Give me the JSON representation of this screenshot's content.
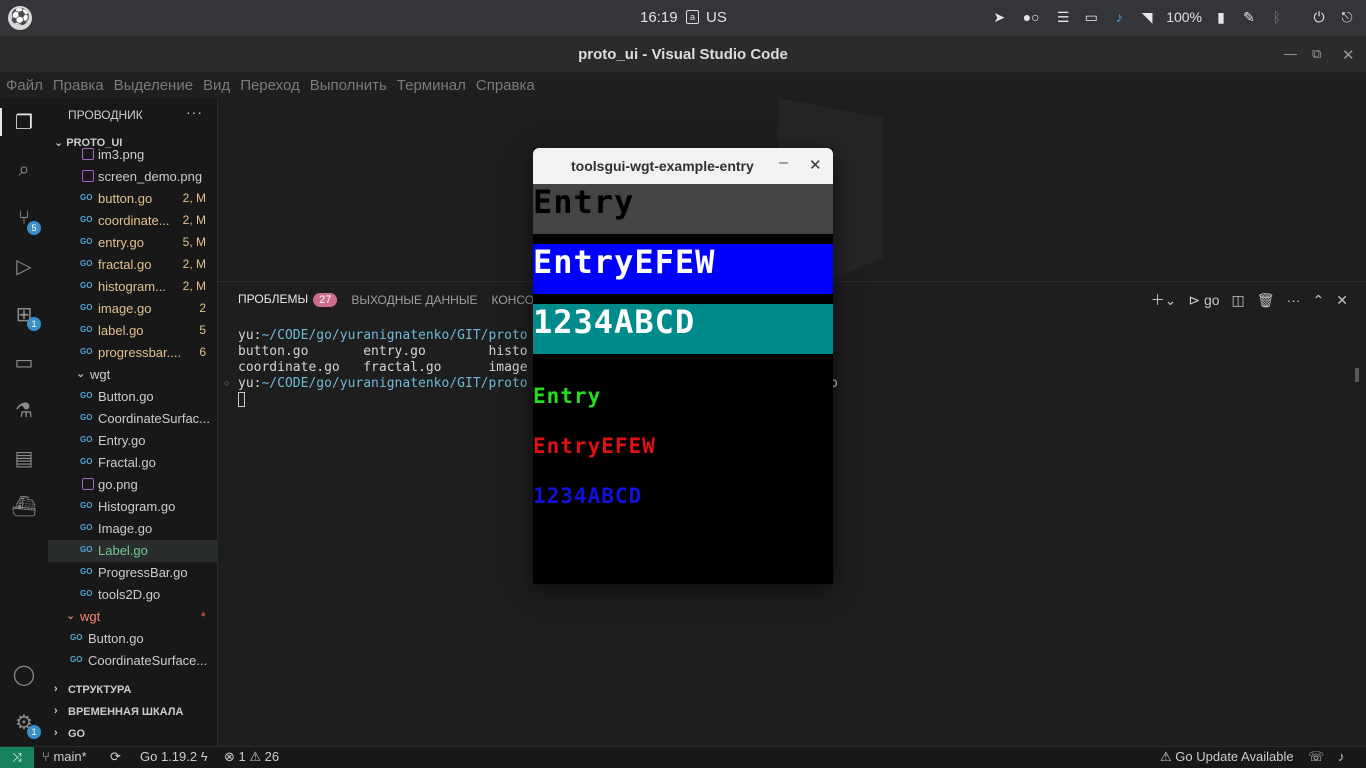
{
  "system_bar": {
    "clock": "16:19",
    "keyboard_layout": "US",
    "battery": "100%"
  },
  "window": {
    "title": "proto_ui - Visual Studio Code"
  },
  "menu": [
    "Файл",
    "Правка",
    "Выделение",
    "Вид",
    "Переход",
    "Выполнить",
    "Терминал",
    "Справка"
  ],
  "activity": {
    "scm_badge": "5",
    "extensions_badge": "1",
    "settings_badge": "1"
  },
  "sidebar": {
    "header": "ПРОВОДНИК",
    "more": "···",
    "project": "PROTO_UI",
    "files": [
      {
        "name": "im3.png",
        "status": "",
        "kind": "png",
        "level": 1,
        "color": "normal"
      },
      {
        "name": "screen_demo.png",
        "status": "",
        "kind": "png",
        "level": 1,
        "color": "normal"
      },
      {
        "name": "button.go",
        "status": "2, M",
        "kind": "go",
        "level": 1,
        "color": "mod"
      },
      {
        "name": "coordinate...",
        "status": "2, M",
        "kind": "go",
        "level": 1,
        "color": "mod"
      },
      {
        "name": "entry.go",
        "status": "5, M",
        "kind": "go",
        "level": 1,
        "color": "mod"
      },
      {
        "name": "fractal.go",
        "status": "2, M",
        "kind": "go",
        "level": 1,
        "color": "mod"
      },
      {
        "name": "histogram...",
        "status": "2, M",
        "kind": "go",
        "level": 1,
        "color": "mod"
      },
      {
        "name": "image.go",
        "status": "2",
        "kind": "go",
        "level": 1,
        "color": "mod"
      },
      {
        "name": "label.go",
        "status": "5",
        "kind": "go",
        "level": 1,
        "color": "mod"
      },
      {
        "name": "progressbar....",
        "status": "6",
        "kind": "go",
        "level": 1,
        "color": "mod"
      },
      {
        "name": "wgt",
        "status": "",
        "kind": "folder",
        "level": 1,
        "color": "normal"
      },
      {
        "name": "Button.go",
        "status": "",
        "kind": "go",
        "level": 1,
        "color": "normal"
      },
      {
        "name": "CoordinateSurfac...",
        "status": "",
        "kind": "go",
        "level": 1,
        "color": "normal"
      },
      {
        "name": "Entry.go",
        "status": "",
        "kind": "go",
        "level": 1,
        "color": "normal"
      },
      {
        "name": "Fractal.go",
        "status": "",
        "kind": "go",
        "level": 1,
        "color": "normal"
      },
      {
        "name": "go.png",
        "status": "",
        "kind": "png",
        "level": 1,
        "color": "normal"
      },
      {
        "name": "Histogram.go",
        "status": "",
        "kind": "go",
        "level": 1,
        "color": "normal"
      },
      {
        "name": "Image.go",
        "status": "",
        "kind": "go",
        "level": 1,
        "color": "normal"
      },
      {
        "name": "Label.go",
        "status": "",
        "kind": "go",
        "level": 1,
        "color": "green"
      },
      {
        "name": "ProgressBar.go",
        "status": "",
        "kind": "go",
        "level": 1,
        "color": "normal"
      },
      {
        "name": "tools2D.go",
        "status": "",
        "kind": "go",
        "level": 1,
        "color": "normal"
      },
      {
        "name": "wgt",
        "status": "●",
        "kind": "folder",
        "level": 0,
        "color": "err"
      },
      {
        "name": "Button.go",
        "status": "",
        "kind": "go",
        "level": 0,
        "color": "normal"
      },
      {
        "name": "CoordinateSurface...",
        "status": "",
        "kind": "go",
        "level": 0,
        "color": "normal"
      }
    ],
    "sections": [
      "СТРУКТУРА",
      "ВРЕМЕННАЯ ШКАЛА",
      "GO"
    ]
  },
  "panel": {
    "tabs": [
      {
        "label": "ПРОБЛЕМЫ",
        "count": "27"
      },
      {
        "label": "ВЫХОДНЫЕ ДАННЫЕ",
        "count": ""
      },
      {
        "label": "КОНСОЛЬ ОТЛАДКИ",
        "count": ""
      }
    ],
    "shell_label": "go",
    "terminal": {
      "prompt_user": "yu:",
      "prompt_path": "~/CODE/go/yuranignatenko/GIT/proto",
      "line2": "button.go       entry.go        histo",
      "line3": "coordinate.go   fractal.go      image",
      "prompt_suffix": "o"
    }
  },
  "status": {
    "branch": "main*",
    "go_version": "Go 1.19.2",
    "errors": "1",
    "warnings": "26",
    "go_update": "Go Update Available"
  },
  "app_window": {
    "title": "toolsgui-wgt-example-entry",
    "entries": [
      {
        "text": "Entry",
        "bg": "#444444",
        "fg": "#000000",
        "size": "large"
      },
      {
        "text": "EntryEFEW",
        "bg": "#0000ff",
        "fg": "#ffffff",
        "size": "large"
      },
      {
        "text": "1234ABCD",
        "bg": "#008b8b",
        "fg": "#ffffff",
        "size": "large"
      },
      {
        "text": "Entry",
        "bg": "#000000",
        "fg": "#22dd22",
        "size": "small"
      },
      {
        "text": "EntryEFEW",
        "bg": "#000000",
        "fg": "#dd1111",
        "size": "small"
      },
      {
        "text": "1234ABCD",
        "bg": "#000000",
        "fg": "#1111dd",
        "size": "small"
      }
    ]
  }
}
